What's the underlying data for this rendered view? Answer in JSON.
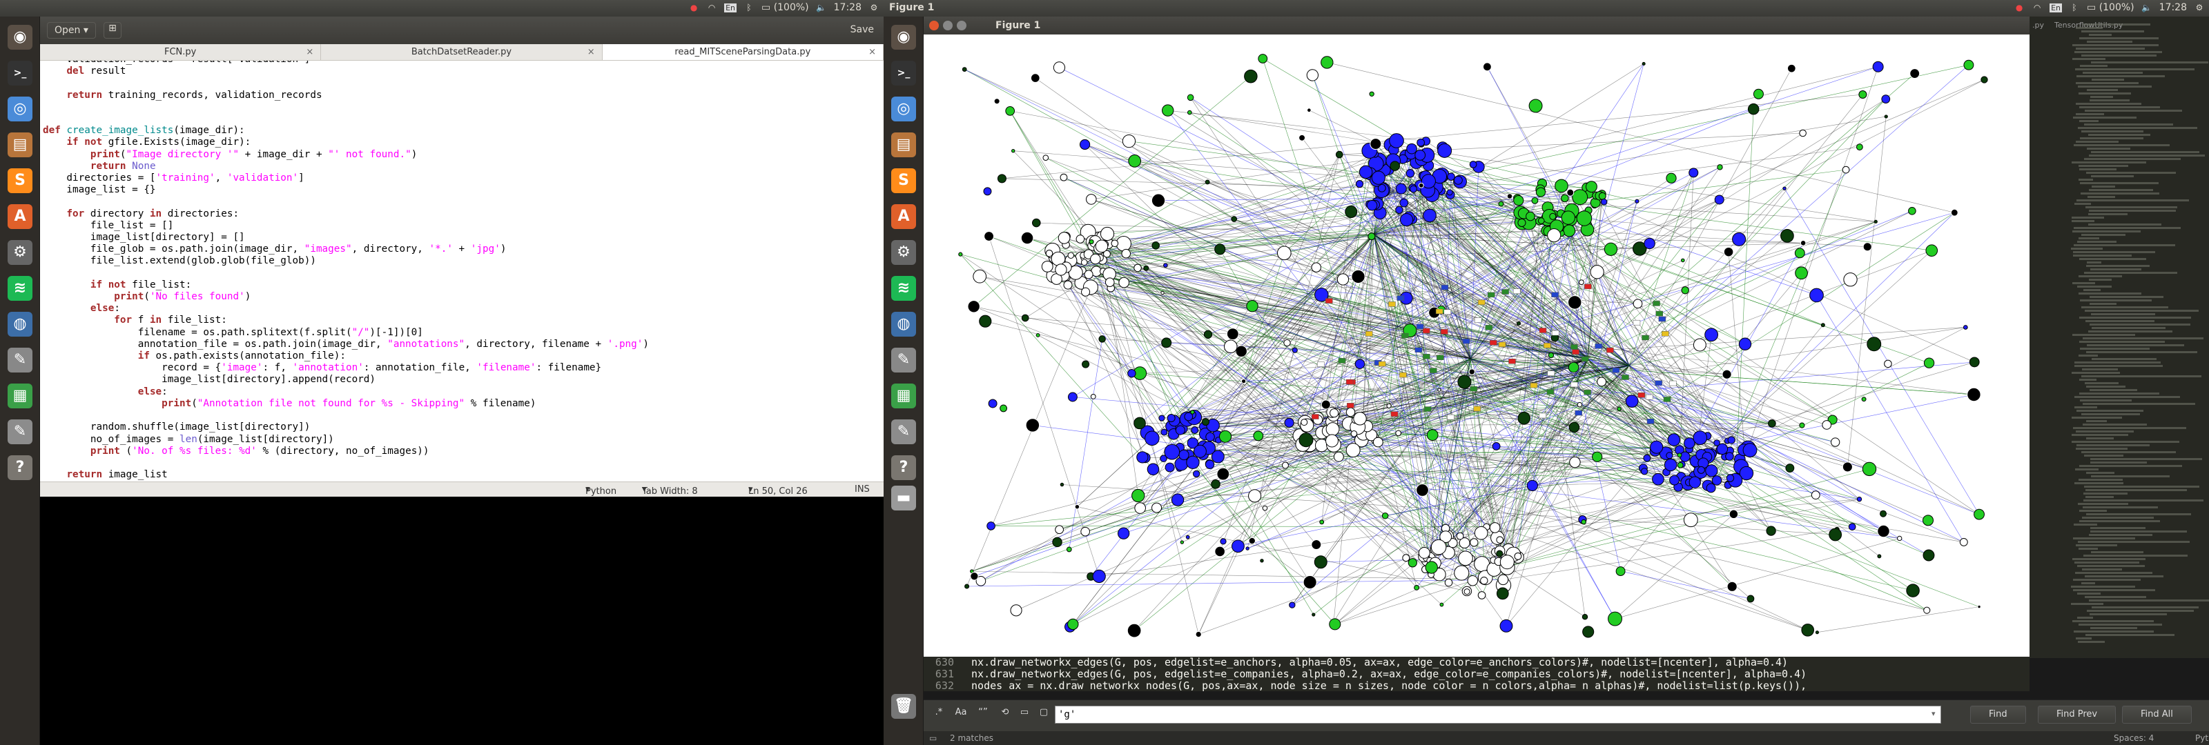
{
  "left_screen": {
    "top_panel": {
      "time": "17:28",
      "battery": "(100%)",
      "keyboard": "En"
    },
    "launcher": [
      {
        "name": "ubuntu-dash-icon",
        "color": "#5a4f45"
      },
      {
        "name": "terminal-icon",
        "color": "#333333"
      },
      {
        "name": "chrome-icon",
        "color": "#4a8bd8"
      },
      {
        "name": "files-icon",
        "color": "#b8753b"
      },
      {
        "name": "sublime-icon",
        "color": "#ff8c1a"
      },
      {
        "name": "software-center-icon",
        "color": "#e0602a"
      },
      {
        "name": "settings-icon",
        "color": "#666666"
      },
      {
        "name": "spotify-icon",
        "color": "#1db954"
      },
      {
        "name": "globe-icon",
        "color": "#3c6ea8"
      },
      {
        "name": "editor-icon",
        "color": "#888888"
      },
      {
        "name": "spreadsheet-icon",
        "color": "#3aa048"
      },
      {
        "name": "text-editor-icon",
        "color": "#8c8c8c"
      },
      {
        "name": "help-icon",
        "color": "#7a7670"
      }
    ],
    "gedit": {
      "open_label": "Open",
      "save_label": "Save",
      "tabs": [
        "FCN.py",
        "BatchDatsetReader.py",
        "read_MITSceneParsingData.py"
      ],
      "status": {
        "language": "Python",
        "tab_width": "Tab Width: 8",
        "position": "Ln 50, Col 26",
        "mode": "INS"
      }
    }
  },
  "right_screen": {
    "top_panel": {
      "title": "Figure 1",
      "time": "17:28",
      "battery": "(100%)",
      "keyboard": "En"
    },
    "figure": {
      "title": "Figure 1"
    },
    "sublime": {
      "tabs": [
        ".py",
        "TensorflowUtils.py"
      ],
      "lines": [
        {
          "no": "630",
          "text": "    nx.draw_networkx_edges(G, pos, edgelist=e_anchors, alpha=0.05, ax=ax, edge_color=e_anchors_colors)#, nodelist=[ncenter], alpha=0.4)"
        },
        {
          "no": "631",
          "text": "    nx.draw_networkx_edges(G, pos, edgelist=e_companies, alpha=0.2, ax=ax, edge_color=e_companies_colors)#, nodelist=[ncenter], alpha=0.4)"
        },
        {
          "no": "632",
          "text": "    nodes_ax = nx.draw_networkx_nodes(G, pos,ax=ax, node_size = n_sizes, node_color = n_colors,alpha= n_alphas)#, nodelist=list(p.keys()),"
        }
      ],
      "find": {
        "query": "'g'",
        "find": "Find",
        "find_prev": "Find Prev",
        "find_all": "Find All"
      },
      "status": {
        "matches": "2 matches",
        "spaces": "Spaces: 4",
        "syntax": "Python"
      }
    }
  }
}
